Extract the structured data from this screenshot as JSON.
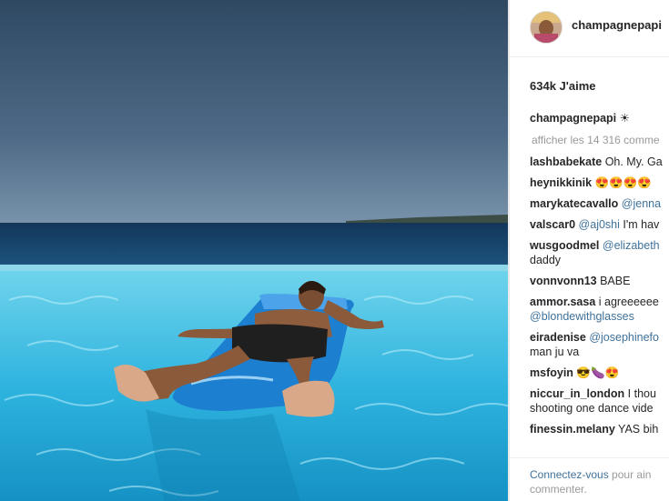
{
  "post": {
    "username": "champagnepapi",
    "likes": "634k J'aime",
    "caption_user": "champagnepapi",
    "caption_text": " ☀",
    "view_all": "afficher les 14 316 comme"
  },
  "comments": [
    {
      "user": "lashbabekate",
      "text": " Oh. My. Ga",
      "line2": ""
    },
    {
      "user": "heynikkinik",
      "text": " 😍😍😍😍",
      "line2": ""
    },
    {
      "user": "marykatecavallo",
      "text": " @jenna",
      "line2": ""
    },
    {
      "user": "valscar0",
      "text": " @aj0shi I'm hav",
      "line2": ""
    },
    {
      "user": "wusgoodmel",
      "text": " @elizabeth",
      "line2": "daddy"
    },
    {
      "user": "vonnvonn13",
      "text": " BABE",
      "line2": ""
    },
    {
      "user": "ammor.sasa",
      "text": " i agreeeeee",
      "line2": "@blondewithglasses"
    },
    {
      "user": "eiradenise",
      "text": " @josephinefo",
      "line2": "man ju va"
    },
    {
      "user": "msfoyin",
      "text": " 😎🍆😍",
      "line2": ""
    },
    {
      "user": "niccur_in_london",
      "text": " I thou",
      "line2": "shooting one dance vide"
    },
    {
      "user": "finessin.melany",
      "text": " YAS bih",
      "line2": ""
    }
  ],
  "footer": {
    "link": "Connectez-vous",
    "text": " pour ain",
    "line2": "commenter."
  },
  "colors": {
    "link": "#3f729b",
    "muted": "#999999",
    "text": "#262626"
  }
}
